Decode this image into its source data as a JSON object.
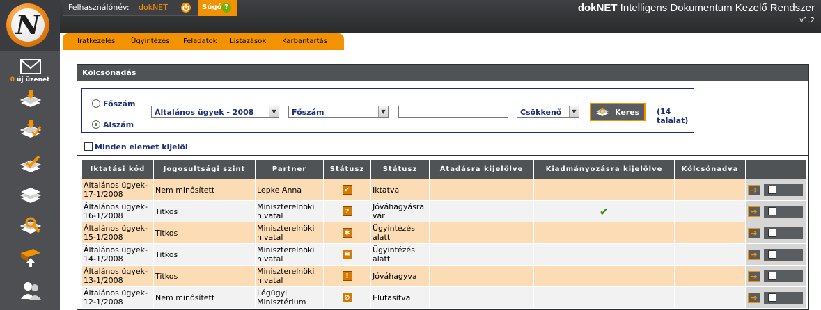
{
  "sidebar": {
    "logo_letter": "N",
    "messages": {
      "count": "0",
      "label": " új üzenet"
    },
    "icons": [
      "envelope-icon",
      "inbox-stack-icon",
      "download-stack-icon",
      "approve-stack-icon",
      "document-stack-icon",
      "search-stack-icon",
      "export-icon",
      "users-icon"
    ]
  },
  "header": {
    "user_label": "Felhasználónév:",
    "user_name": "dokNET",
    "help_label": "Súgó",
    "help_icon_glyph": "?",
    "app_title_bold": "dokNET",
    "app_title_rest": " Intelligens Dokumentum Kezelő Rendszer",
    "version": "v1.2"
  },
  "menu": [
    "Iratkezelés",
    "Ügyintézés",
    "Feladatok",
    "Listázások",
    "Karbantartás"
  ],
  "panel": {
    "title": "Kölcsönadás",
    "search": {
      "radio_main": "Főszám",
      "radio_sub": "Alszám",
      "selected_radio": "Alszám",
      "year_select": "Általános ügyek - 2008",
      "field_select": "Főszám",
      "search_value": "",
      "order_select": "Csökkenő",
      "button_label": "Keres",
      "result_count": "(14 találat)"
    },
    "select_all_label": "Minden elemet kijelöl"
  },
  "table": {
    "headers": [
      "Iktatási kód",
      "Jogosultsági szint",
      "Partner",
      "Státusz",
      "Státusz",
      "Átadásra kijelölve",
      "Kiadmányozásra kijelölve",
      "Kölcsönadva",
      ""
    ],
    "rows": [
      {
        "code": "Általános ügyek-17-1/2008",
        "level": "Nem minősített",
        "partner": "Lepke Anna",
        "status_icon": "✔",
        "status": "Iktatva",
        "handover": "",
        "signing": "",
        "lent": ""
      },
      {
        "code": "Általános ügyek-16-1/2008",
        "level": "Titkos",
        "partner": "Miniszterelnöki hivatal",
        "status_icon": "?",
        "status": "Jóváhagyásra vár",
        "handover": "",
        "signing": "✔",
        "lent": ""
      },
      {
        "code": "Általános ügyek-15-1/2008",
        "level": "Titkos",
        "partner": "Miniszterelnöki hivatal",
        "status_icon": "✱",
        "status": "Ügyintézés alatt",
        "handover": "",
        "signing": "",
        "lent": ""
      },
      {
        "code": "Általános ügyek-14-1/2008",
        "level": "Titkos",
        "partner": "Miniszterelnöki hivatal",
        "status_icon": "✱",
        "status": "Ügyintézés alatt",
        "handover": "",
        "signing": "",
        "lent": ""
      },
      {
        "code": "Általános ügyek-13-1/2008",
        "level": "Titkos",
        "partner": "Miniszterelnöki hivatal",
        "status_icon": "!",
        "status": "Jóváhagyva",
        "handover": "",
        "signing": "",
        "lent": ""
      },
      {
        "code": "Általános ügyek-12-1/2008",
        "level": "Nem minősített",
        "partner": "Légügyi Minisztérium",
        "status_icon": "⊘",
        "status": "Elutasítva",
        "handover": "",
        "signing": "",
        "lent": ""
      }
    ]
  },
  "colors": {
    "accent": "#f39200",
    "dark": "#505356",
    "row_odd": "#fcdcb4",
    "row_even": "#f2f2f2",
    "text_blue": "#1c2f7a"
  }
}
